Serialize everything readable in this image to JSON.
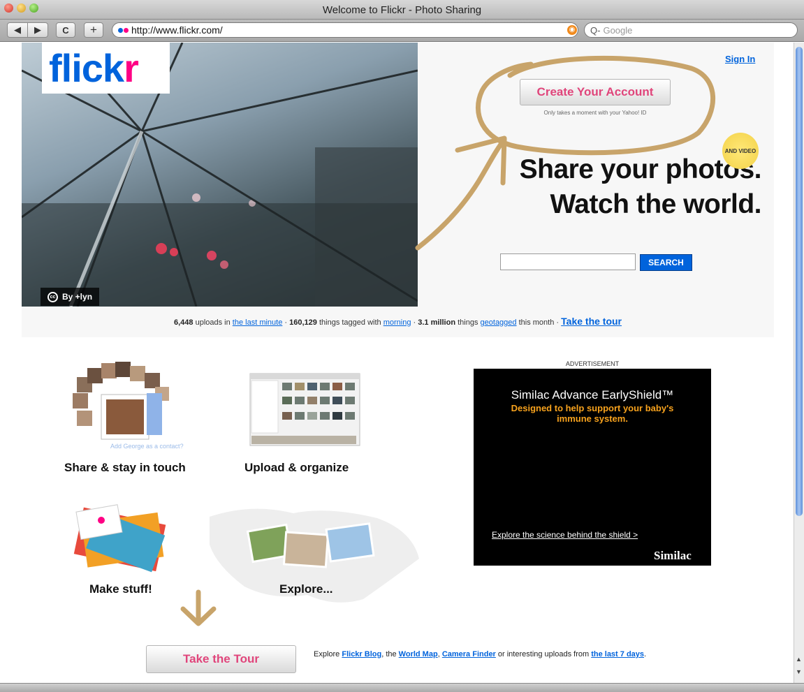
{
  "window": {
    "title": "Welcome to Flickr - Photo Sharing"
  },
  "toolbar": {
    "back_glyph": "◀",
    "forward_glyph": "▶",
    "reload_glyph": "C",
    "add_bookmark_glyph": "+",
    "url": "http://www.flickr.com/",
    "search_placeholder": "Google",
    "search_icon": "Q-"
  },
  "logo": {
    "part1": "flick",
    "part2": "r"
  },
  "photo": {
    "credit": "By +lyn",
    "cc_icon": "cc"
  },
  "header": {
    "sign_in": "Sign In",
    "create_account": "Create Your Account",
    "create_note": "Only takes a moment with your Yahoo! ID",
    "badge": "AND VIDEO",
    "headline_1": "Share your photos.",
    "headline_2": "Watch the world.",
    "search_button": "SEARCH"
  },
  "stats": {
    "uploads_count": "6,448",
    "uploads_text": "uploads in",
    "uploads_link": "the last minute",
    "tagged_count": "160,129",
    "tagged_text": "things tagged with",
    "tagged_link": "morning",
    "geo_count": "3.1 million",
    "geo_text": "things",
    "geo_link": "geotagged",
    "geo_suffix": "this month",
    "separator": "·",
    "tour_link": "Take the tour"
  },
  "features": {
    "share": "Share & stay in touch",
    "share_caption": "Add George as a contact?",
    "upload": "Upload & organize",
    "make": "Make stuff!",
    "explore": "Explore..."
  },
  "ad": {
    "label": "ADVERTISEMENT",
    "title": "Similac Advance EarlyShield™",
    "subtitle": "Designed to help support your baby's immune system.",
    "link": "Explore the science behind the shield >",
    "brand": "Similac",
    "product_label": "EarlyShield",
    "can_label": "Similac Advance"
  },
  "footer": {
    "tour_button": "Take the Tour",
    "explore_prefix": "Explore",
    "blog_link": "Flickr Blog",
    "text_2": ", the",
    "map_link": "World Map",
    "text_3": ",",
    "camera_link": "Camera Finder",
    "text_4": "or interesting uploads from",
    "recent_link": "the last 7 days",
    "text_5": "."
  },
  "colors": {
    "flickr_blue": "#0063dc",
    "flickr_pink": "#ff0084",
    "button_pink": "#e0457b",
    "annotation": "#c8a46a",
    "ad_orange": "#f7a21d"
  },
  "icons": [
    "back-icon",
    "forward-icon",
    "reload-icon",
    "add-bookmark-icon",
    "flickr-dots-icon",
    "rss-icon",
    "search-icon",
    "cc-icon"
  ]
}
